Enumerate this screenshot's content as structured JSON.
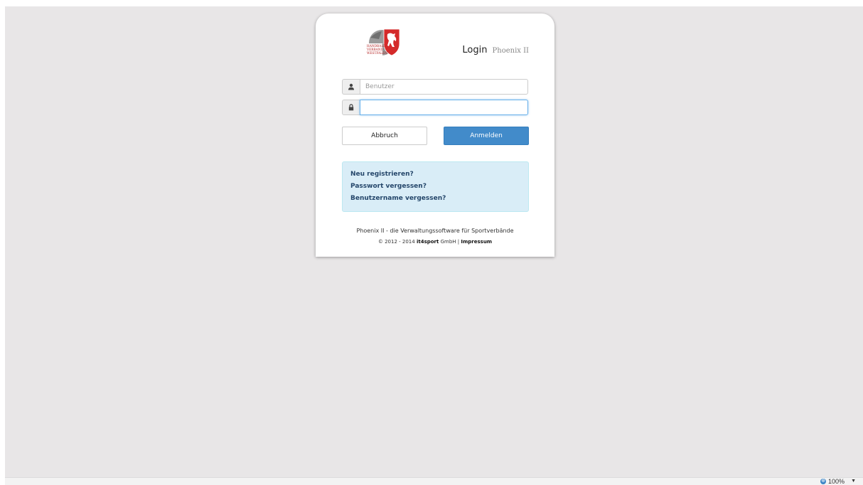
{
  "header": {
    "title_main": "Login",
    "title_sub": "Phoenix II"
  },
  "logo": {
    "icon": "handballverband-westfalen-logo",
    "lines": [
      "HANDBALL",
      "VERBAND",
      "WESTFALEN"
    ],
    "colors": {
      "red": "#d42a2a",
      "gray": "#8a8a8a"
    }
  },
  "form": {
    "username": {
      "icon": "user-icon",
      "placeholder": "Benutzer",
      "value": ""
    },
    "password": {
      "icon": "lock-icon",
      "placeholder": "",
      "value": ""
    },
    "cancel_label": "Abbruch",
    "login_label": "Anmelden"
  },
  "links": {
    "register": "Neu registrieren?",
    "forgot_password": "Passwort vergessen?",
    "forgot_username": "Benutzername vergessen?"
  },
  "footer": {
    "tagline": "Phoenix II - die Verwaltungssoftware für Sportverbände",
    "copyright_prefix": "© 2012 - 2014",
    "company_bold": "it4sport",
    "company_rest": "GmbH",
    "separator": "|",
    "impressum": "Impressum"
  },
  "statusbar": {
    "zoom": "100%"
  },
  "colors": {
    "background": "#e8e6e7",
    "primary": "#428bca",
    "info_bg": "#d9edf7",
    "link": "#24466a"
  }
}
